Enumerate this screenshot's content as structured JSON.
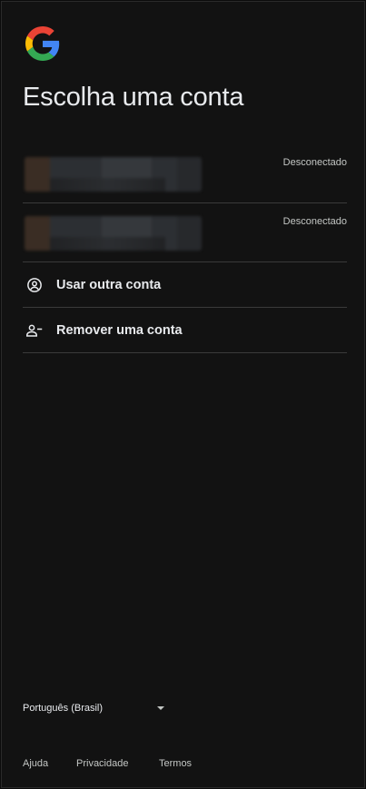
{
  "page": {
    "title": "Escolha uma conta"
  },
  "accounts": [
    {
      "status": "Desconectado"
    },
    {
      "status": "Desconectado"
    }
  ],
  "actions": [
    {
      "label": "Usar outra conta",
      "icon": "account-circle-icon"
    },
    {
      "label": "Remover uma conta",
      "icon": "person-remove-icon"
    }
  ],
  "footer": {
    "language": "Português (Brasil)",
    "links": [
      "Ajuda",
      "Privacidade",
      "Termos"
    ]
  },
  "colors": {
    "background": "#121212",
    "text": "#e8eaed",
    "divider": "#3a3a3a",
    "google_blue": "#4285F4",
    "google_red": "#EA4335",
    "google_yellow": "#FBBC05",
    "google_green": "#34A853"
  }
}
